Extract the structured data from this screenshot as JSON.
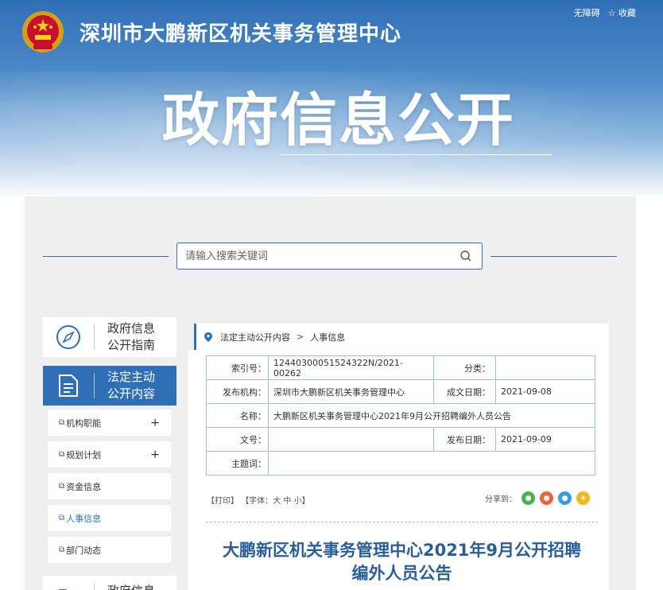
{
  "header": {
    "site_title": "深圳市大鹏新区机关事务管理中心",
    "big_title": "政府信息公开",
    "accessibility_link": "无障碍",
    "favorite_link": "收藏",
    "favorite_icon": "☆"
  },
  "search": {
    "placeholder": "请输入搜索关键词"
  },
  "sidebar": {
    "guide_label": "政府信息公开指南",
    "statutory_label": "法定主动公开内容",
    "items": [
      {
        "label": "机构职能",
        "expandable": "+"
      },
      {
        "label": "规划计划",
        "expandable": "+"
      },
      {
        "label": "资金信息"
      },
      {
        "label": "人事信息"
      },
      {
        "label": "部门动态"
      }
    ],
    "bottom_label": "政府信息"
  },
  "breadcrumb": {
    "root": "法定主动公开内容",
    "separator": ">",
    "current": "人事信息"
  },
  "meta": {
    "index_key": "索引号：",
    "index_val": "12440300051524322N/2021-00262",
    "category_key": "分类：",
    "category_val": "",
    "publisher_key": "发布机构：",
    "publisher_val": "深圳市大鹏新区机关事务管理中心",
    "created_key": "成文日期：",
    "created_val": "2021-09-08",
    "name_key": "名称：",
    "name_val": "大鹏新区机关事务管理中心2021年9月公开招聘编外人员公告",
    "docno_key": "文号：",
    "docno_val": "",
    "pubdate_key": "发布日期：",
    "pubdate_val": "2021-09-09",
    "subject_key": "主题词：",
    "subject_val": ""
  },
  "tools": {
    "print": "【打印】",
    "font_prefix": "【字体：",
    "font_large": "大",
    "font_medium": "中",
    "font_small": "小",
    "font_suffix": "】",
    "share_label": "分享到：",
    "share_colors": [
      "#4caf50",
      "#e8643c",
      "#3b9be0",
      "#f2b81e"
    ]
  },
  "article": {
    "title_line1": "大鹏新区机关事务管理中心2021年9月公开招聘",
    "title_line2": "编外人员公告"
  },
  "colors": {
    "brand_blue": "#2f6fb6",
    "title_blue": "#2a5e99",
    "panel_bg": "#efefef"
  }
}
